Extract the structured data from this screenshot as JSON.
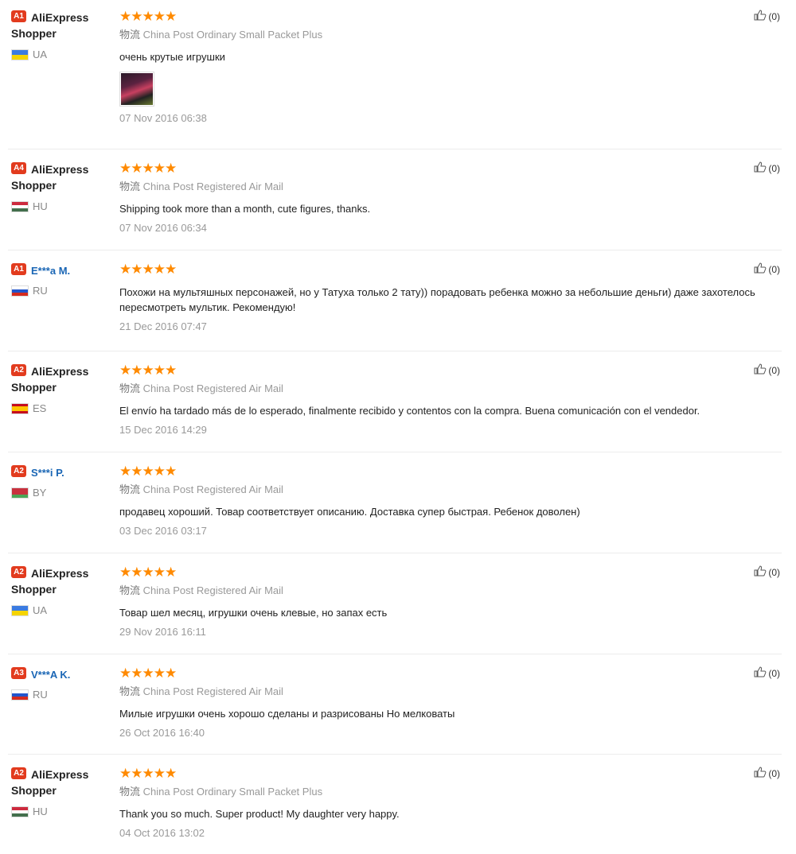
{
  "reviews": [
    {
      "badge": "A1",
      "name_line1": "AliExpress",
      "name_line2": "Shopper",
      "masked": false,
      "country": "UA",
      "flag": "ua",
      "stars": "★★★★★",
      "logistics_cn": "物流",
      "logistics": "China Post Ordinary Small Packet Plus",
      "content": "очень крутые игрушки",
      "has_photo": true,
      "date": "07 Nov 2016 06:38",
      "likes": "(0)"
    },
    {
      "badge": "A4",
      "name_line1": "AliExpress",
      "name_line2": "Shopper",
      "masked": false,
      "country": "HU",
      "flag": "hu",
      "stars": "★★★★★",
      "logistics_cn": "物流",
      "logistics": "China Post Registered Air Mail",
      "content": "Shipping took more than a month, cute figures, thanks.",
      "has_photo": false,
      "date": "07 Nov 2016 06:34",
      "likes": "(0)"
    },
    {
      "badge": "A1",
      "name_line1": "E***a M.",
      "name_line2": "",
      "masked": true,
      "country": "RU",
      "flag": "ru",
      "stars": "★★★★★",
      "logistics_cn": "",
      "logistics": "",
      "content": "Похожи на мультяшных персонажей, но у Татуха только 2 тату)) порадовать ребенка можно за небольшие деньги) даже захотелось пересмотреть мультик. Рекомендую!",
      "has_photo": false,
      "date": "21 Dec 2016 07:47",
      "likes": "(0)"
    },
    {
      "badge": "A2",
      "name_line1": "AliExpress",
      "name_line2": "Shopper",
      "masked": false,
      "country": "ES",
      "flag": "es",
      "stars": "★★★★★",
      "logistics_cn": "物流",
      "logistics": "China Post Registered Air Mail",
      "content": "El envío ha tardado más de lo esperado, finalmente recibido y contentos con la compra. Buena comunicación con el vendedor.",
      "has_photo": false,
      "date": "15 Dec 2016 14:29",
      "likes": "(0)"
    },
    {
      "badge": "A2",
      "name_line1": "S***i P.",
      "name_line2": "",
      "masked": true,
      "country": "BY",
      "flag": "by",
      "stars": "★★★★★",
      "logistics_cn": "物流",
      "logistics": "China Post Registered Air Mail",
      "content": "продавец хороший. Товар соответствует описанию. Доставка супер быстрая. Ребенок доволен)",
      "has_photo": false,
      "date": "03 Dec 2016 03:17",
      "likes": ""
    },
    {
      "badge": "A2",
      "name_line1": "AliExpress",
      "name_line2": "Shopper",
      "masked": false,
      "country": "UA",
      "flag": "ua",
      "stars": "★★★★★",
      "logistics_cn": "物流",
      "logistics": "China Post Registered Air Mail",
      "content": "Товар шел месяц, игрушки очень клевые, но запах есть",
      "has_photo": false,
      "date": "29 Nov 2016 16:11",
      "likes": "(0)"
    },
    {
      "badge": "A3",
      "name_line1": "V***A K.",
      "name_line2": "",
      "masked": true,
      "country": "RU",
      "flag": "ru",
      "stars": "★★★★★",
      "logistics_cn": "物流",
      "logistics": "China Post Registered Air Mail",
      "content": "Милые игрушки очень хорошо сделаны и разрисованы Но мелковаты",
      "has_photo": false,
      "date": "26 Oct 2016 16:40",
      "likes": "(0)"
    },
    {
      "badge": "A2",
      "name_line1": "AliExpress",
      "name_line2": "Shopper",
      "masked": false,
      "country": "HU",
      "flag": "hu",
      "stars": "★★★★★",
      "logistics_cn": "物流",
      "logistics": "China Post Ordinary Small Packet Plus",
      "content": "Thank you so much. Super product! My daughter very happy.",
      "has_photo": false,
      "date": "04 Oct 2016 13:02",
      "likes": "(0)"
    }
  ],
  "colors": {
    "badge": "#e23b1e",
    "stars": "#ff8a00",
    "masked_name": "#1a66b5"
  }
}
